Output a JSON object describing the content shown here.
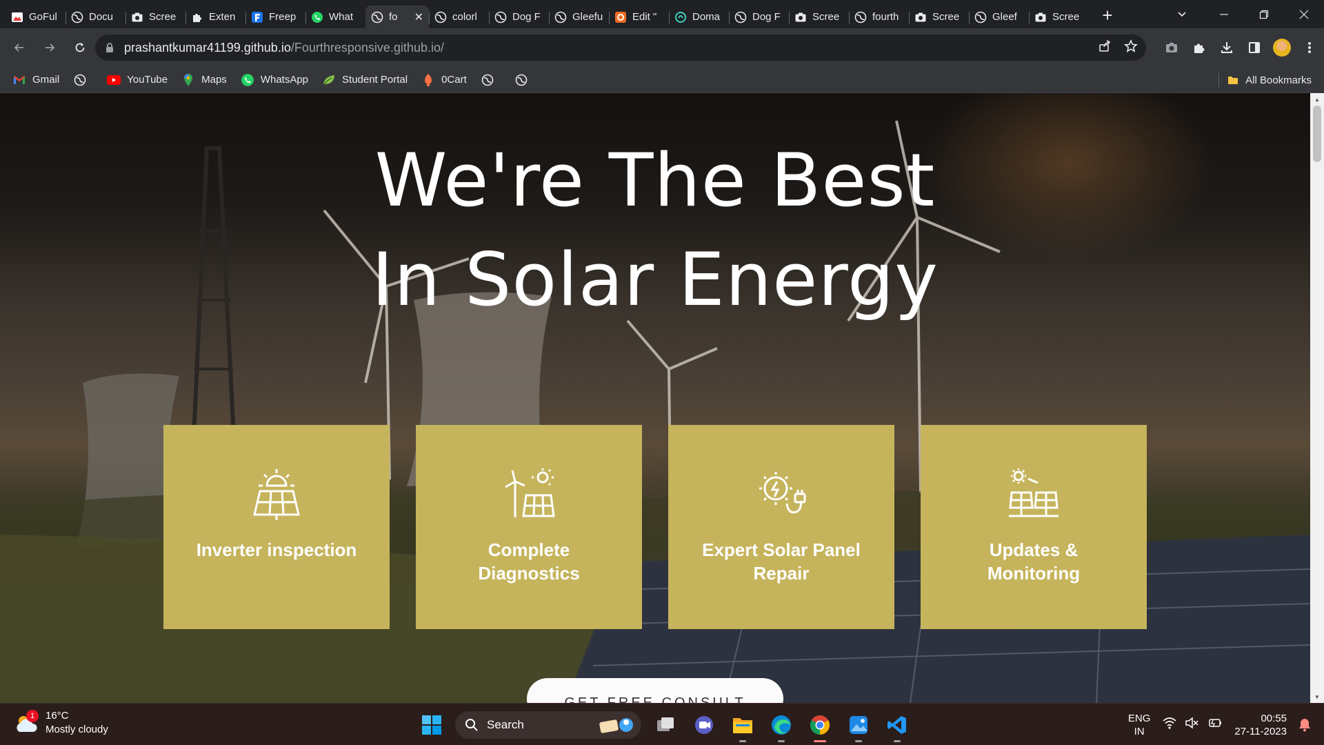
{
  "browser": {
    "tabs": [
      {
        "title": "GoFul",
        "icon": "gofull-icon"
      },
      {
        "title": "Docu",
        "icon": "globe-icon"
      },
      {
        "title": "Scree",
        "icon": "camera-icon"
      },
      {
        "title": "Exten",
        "icon": "puzzle-icon"
      },
      {
        "title": "Freep",
        "icon": "freepik-icon"
      },
      {
        "title": "What",
        "icon": "whatsapp-icon"
      },
      {
        "title": "fo",
        "icon": "globe-icon",
        "active": true
      },
      {
        "title": "colorl",
        "icon": "globe-icon"
      },
      {
        "title": "Dog F",
        "icon": "globe-icon"
      },
      {
        "title": "Gleefu",
        "icon": "globe-icon"
      },
      {
        "title": "Edit \"",
        "icon": "edit-app-icon"
      },
      {
        "title": "Doma",
        "icon": "domain-icon"
      },
      {
        "title": "Dog F",
        "icon": "globe-icon"
      },
      {
        "title": "Scree",
        "icon": "camera-icon"
      },
      {
        "title": "fourth",
        "icon": "globe-icon"
      },
      {
        "title": "Scree",
        "icon": "camera-icon"
      },
      {
        "title": "Gleef",
        "icon": "globe-icon"
      },
      {
        "title": "Scree",
        "icon": "camera-icon"
      }
    ],
    "new_tab_label": "+",
    "url_host": "prashantkumar41199.github.io",
    "url_path": "/Fourthresponsive.github.io/",
    "bookmarks": [
      {
        "label": "Gmail",
        "icon": "gmail-icon"
      },
      {
        "label": "",
        "icon": "globe-icon"
      },
      {
        "label": "YouTube",
        "icon": "youtube-icon"
      },
      {
        "label": "Maps",
        "icon": "maps-icon"
      },
      {
        "label": "WhatsApp",
        "icon": "whatsapp-icon"
      },
      {
        "label": "Student Portal",
        "icon": "leaf-icon"
      },
      {
        "label": "0Cart",
        "icon": "cart-icon"
      },
      {
        "label": "",
        "icon": "globe-icon"
      },
      {
        "label": "",
        "icon": "globe-icon"
      }
    ],
    "all_bookmarks_label": "All Bookmarks"
  },
  "page": {
    "hero_line1": "We're The Best",
    "hero_line2": "In Solar Energy",
    "cards": [
      {
        "title": "Inverter inspection",
        "icon": "solar-panel-sun-icon"
      },
      {
        "title": "Complete Diagnostics",
        "icon": "wind-solar-icon"
      },
      {
        "title": "Expert Solar Panel Repair",
        "icon": "energy-plug-icon"
      },
      {
        "title": "Updates & Monitoring",
        "icon": "solar-array-icon"
      }
    ],
    "cta_label": "GET FREE CONSULT",
    "card_color": "#c5b45c"
  },
  "taskbar": {
    "weather_temp": "16°C",
    "weather_desc": "Mostly cloudy",
    "weather_badge": "1",
    "search_label": "Search",
    "lang_line1": "ENG",
    "lang_line2": "IN",
    "time": "00:55",
    "date": "27-11-2023"
  }
}
